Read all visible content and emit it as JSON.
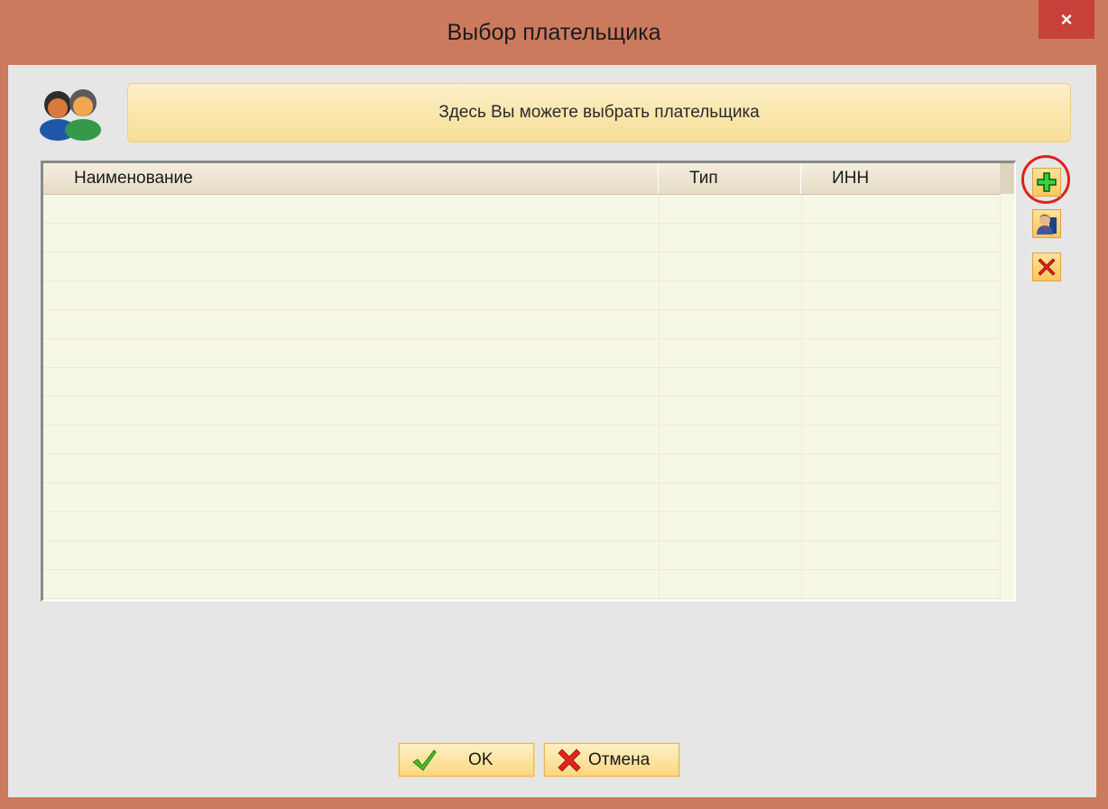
{
  "window": {
    "title": "Выбор плательщика",
    "close_label": "×"
  },
  "banner": {
    "text": "Здесь Вы можете выбрать плательщика"
  },
  "grid": {
    "columns": [
      "Наименование",
      "Тип",
      "ИНН"
    ],
    "rows": []
  },
  "side_toolbar": {
    "buttons": [
      {
        "name": "add",
        "icon": "plus-icon",
        "highlighted": true
      },
      {
        "name": "edit",
        "icon": "person-icon"
      },
      {
        "name": "delete",
        "icon": "delete-x-icon"
      }
    ]
  },
  "footer": {
    "ok_label": "OK",
    "cancel_label": "Отмена"
  },
  "colors": {
    "titlebar": "#cc7a5e",
    "close": "#c7413a",
    "client_bg": "#e6e6e6",
    "banner": "#f7de97",
    "grid_bg": "#f7f7e6",
    "highlight": "#e0201a"
  }
}
